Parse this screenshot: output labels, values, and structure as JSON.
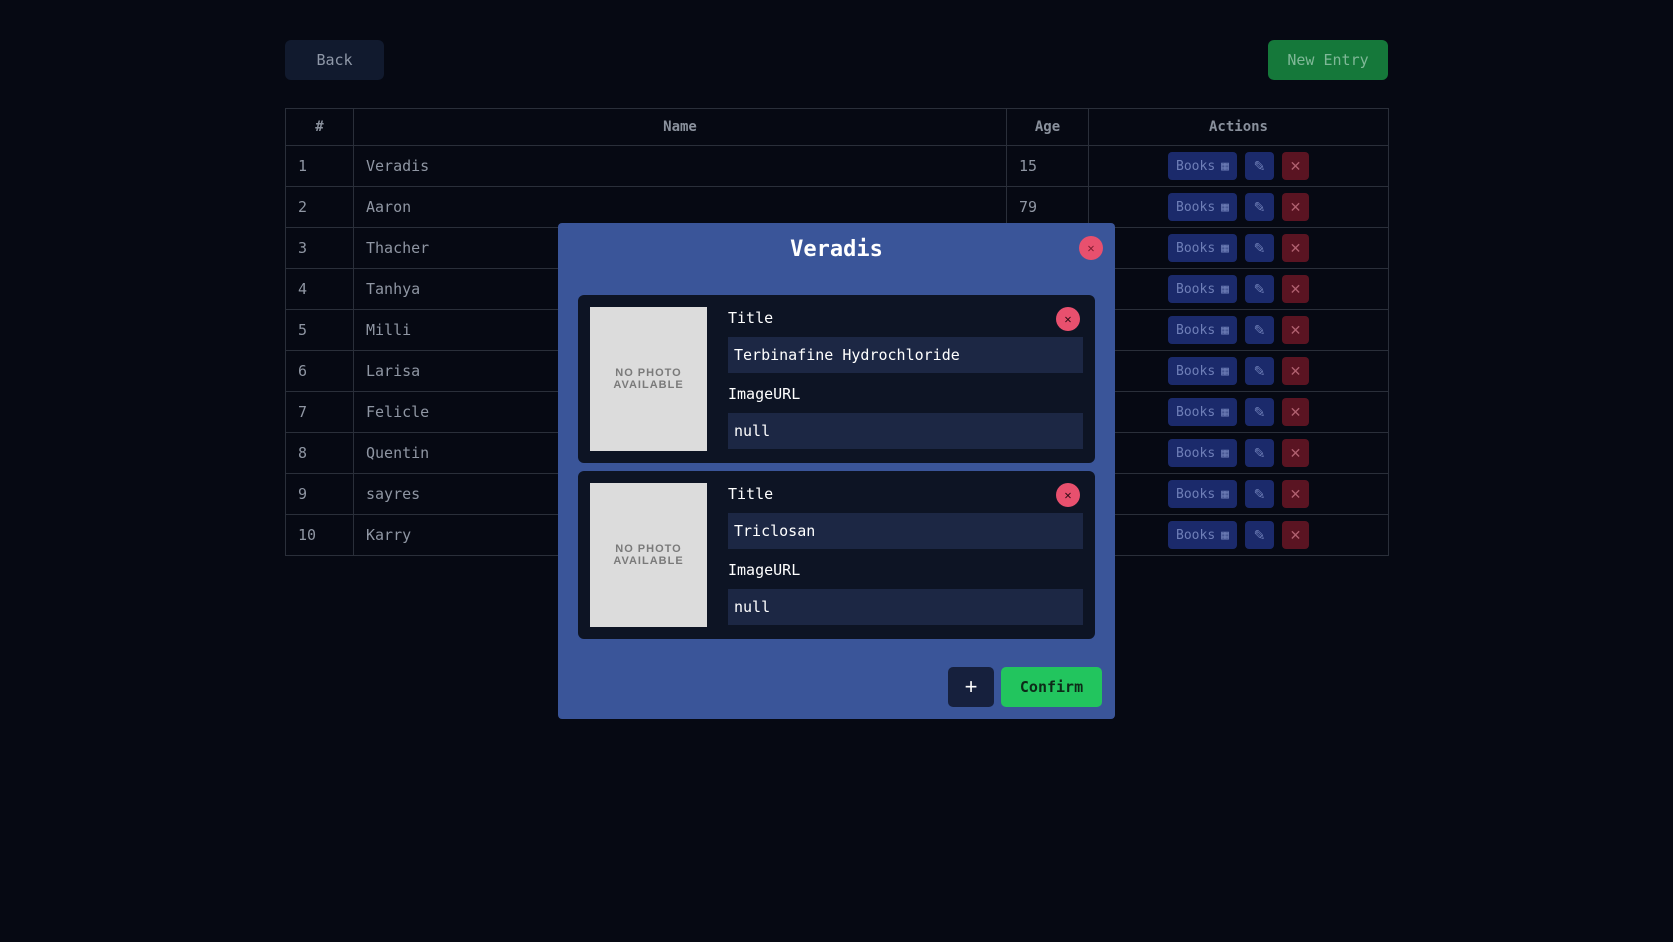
{
  "toolbar": {
    "back_label": "Back",
    "new_entry_label": "New Entry"
  },
  "table": {
    "headers": [
      "#",
      "Name",
      "Age",
      "Actions"
    ],
    "books_label": "Books",
    "rows": [
      {
        "num": "1",
        "name": "Veradis",
        "age": "15"
      },
      {
        "num": "2",
        "name": "Aaron",
        "age": "79"
      },
      {
        "num": "3",
        "name": "Thacher",
        "age": ""
      },
      {
        "num": "4",
        "name": "Tanhya",
        "age": ""
      },
      {
        "num": "5",
        "name": "Milli",
        "age": ""
      },
      {
        "num": "6",
        "name": "Larisa",
        "age": ""
      },
      {
        "num": "7",
        "name": "Felicle",
        "age": ""
      },
      {
        "num": "8",
        "name": "Quentin",
        "age": ""
      },
      {
        "num": "9",
        "name": "sayres",
        "age": ""
      },
      {
        "num": "10",
        "name": "Karry",
        "age": ""
      }
    ]
  },
  "modal": {
    "title": "Veradis",
    "no_photo_line1": "NO PHOTO",
    "no_photo_line2": "AVAILABLE",
    "title_label": "Title",
    "image_label": "ImageURL",
    "books": [
      {
        "title": "Terbinafine Hydrochloride",
        "image_url": "null"
      },
      {
        "title": "Triclosan",
        "image_url": "null"
      }
    ],
    "add_label": "+",
    "confirm_label": "Confirm"
  },
  "colors": {
    "background": "#060913",
    "modal": "#3a5599",
    "confirm": "#22c55e",
    "danger": "#e8506e"
  }
}
